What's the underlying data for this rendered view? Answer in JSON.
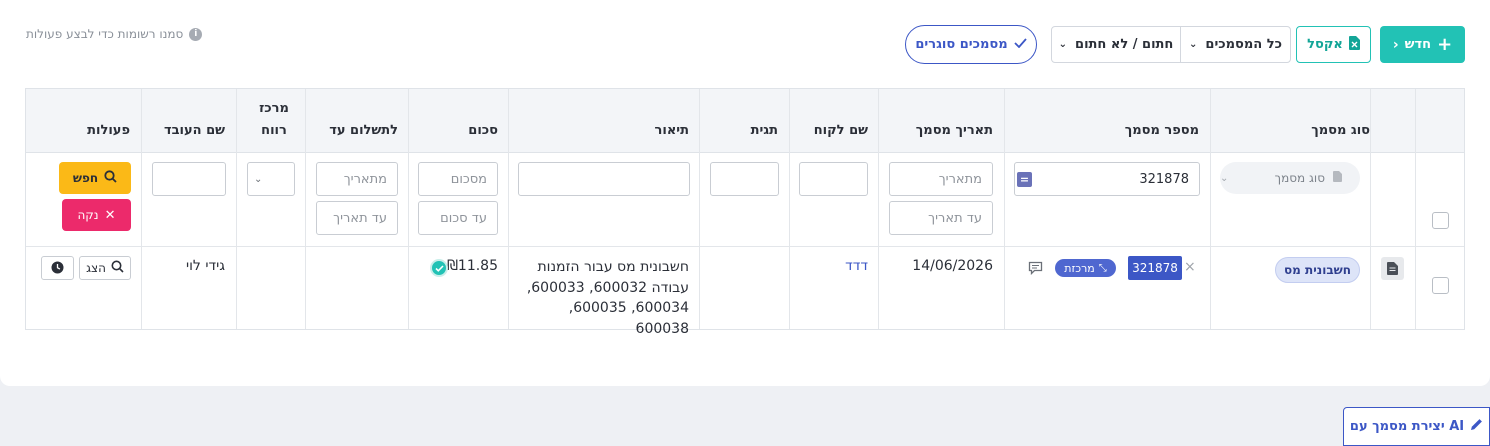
{
  "toolbar": {
    "new_label": "חדש",
    "excel_label": "אקסל",
    "all_docs_label": "כל המסמכים",
    "signed_label": "חתום / לא חתום",
    "closing_docs_label": "מסמכים סוגרים",
    "hint": "סמנו רשומות כדי לבצע פעולות"
  },
  "table": {
    "headers": {
      "doc_type": "סוג מסמך",
      "doc_number": "מספר מסמך",
      "doc_date": "תאריך מסמך",
      "customer": "שם לקוח",
      "tag": "תגית",
      "description": "תיאור",
      "amount": "סכום",
      "pay_until": "לתשלום עד",
      "profit_center_line1": "מרכז",
      "profit_center_line2": "רווח",
      "employee": "שם העובד",
      "actions": "פעולות"
    },
    "filters": {
      "doc_type_placeholder": "סוג מסמך",
      "doc_number_value": "321878",
      "date_from": "מתאריך",
      "date_to": "עד תאריך",
      "amount_from": "מסכום",
      "amount_to": "עד סכום",
      "pay_from": "מתאריך",
      "pay_to": "עד תאריך",
      "search_label": "חפש",
      "clear_label": "נקה"
    },
    "row": {
      "doc_type": "חשבונית מס",
      "doc_number": "321878",
      "centralized_badge": "מרכזת",
      "date": "14/06/2026",
      "customer": "דדד",
      "description": "חשבונית מס עבור הזמנות עבודה 600032, 600033, 600034, 600035, 600038",
      "amount": "₪11.85",
      "employee": "גידי לוי",
      "view_label": "הצג"
    }
  },
  "footer": {
    "ai_button": "יצירת מסמך עם AI"
  },
  "colors": {
    "accent_teal": "#22c2b5",
    "primary_blue": "#3c57c6",
    "search_yellow": "#fbb917",
    "clear_pink": "#ec2a6b"
  }
}
